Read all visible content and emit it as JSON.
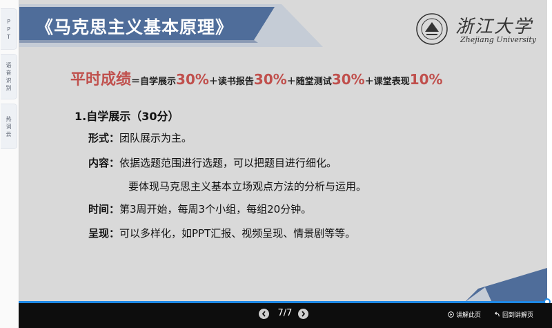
{
  "sidebar": {
    "tabs": [
      {
        "chars": [
          "P",
          "P",
          "T"
        ]
      },
      {
        "chars": [
          "语",
          "音",
          "识",
          "别"
        ]
      },
      {
        "chars": [
          "热",
          "词",
          "云"
        ]
      }
    ]
  },
  "slide": {
    "title": "《马克思主义基本原理》",
    "university_cn": "浙江大学",
    "university_en": "Zhejiang University",
    "headline": {
      "main": "平时成绩",
      "eq": "＝自学展示",
      "p1": "30%",
      "plus1": "＋读书报告",
      "p2": "30%",
      "plus2": "＋随堂测试",
      "p3": "30%",
      "plus3": "＋课堂表现",
      "p4": "10%"
    },
    "section_title": "1.自学展示（30分）",
    "rows": {
      "form_label": "形式：",
      "form_text": "团队展示为主。",
      "content_label": "内容：",
      "content_text": "依据选题范围进行选题，可以把题目进行细化。",
      "content_text2": "要体现马克思主义基本立场观点方法的分析与运用。",
      "time_label": "时间：",
      "time_text": "第3周开始，每周3个小组，每组20分钟。",
      "present_label": "呈现：",
      "present_text": "可以多样化，如PPT汇报、视频呈现、情景剧等等。"
    }
  },
  "controls": {
    "page": "7/7",
    "progress": 1.0,
    "explain_label": "讲解此页",
    "return_label": "回到讲解页",
    "accent": "#1e88e5"
  },
  "colors": {
    "banner": "#4f6d9a",
    "highlight": "#c0504d",
    "slide_bg": "#d9d9d9"
  }
}
